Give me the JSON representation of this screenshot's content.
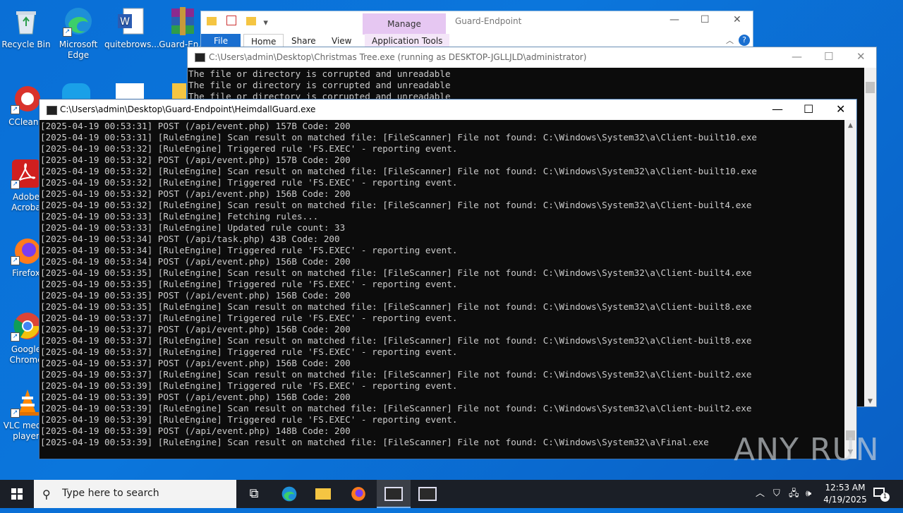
{
  "desktop": {
    "icons": [
      {
        "label": "Recycle Bin"
      },
      {
        "label": "Microsoft Edge"
      },
      {
        "label": "quitebrows..."
      },
      {
        "label": "Guard-En..."
      },
      {
        "label": "CCleane"
      },
      {
        "label": "Adobe Acroba"
      },
      {
        "label": "Firefox"
      },
      {
        "label": "Google Chrome"
      },
      {
        "label": "VLC media player"
      }
    ]
  },
  "explorer": {
    "manage_label": "Manage",
    "title": "Guard-Endpoint",
    "tabs": [
      "File",
      "Home",
      "Share",
      "View",
      "Application Tools"
    ],
    "help": "?"
  },
  "xmas_console": {
    "title": "C:\\Users\\admin\\Desktop\\Christmas Tree.exe (running as DESKTOP-JGLLJLD\\administrator)",
    "lines": [
      "The file or directory is corrupted and unreadable",
      "The file or directory is corrupted and unreadable",
      "The file or directory is corrupted and unreadable"
    ]
  },
  "heim_console": {
    "title": "C:\\Users\\admin\\Desktop\\Guard-Endpoint\\HeimdallGuard.exe",
    "lines": [
      "[2025-04-19 00:53:31] POST (/api/event.php) 157B Code: 200",
      "[2025-04-19 00:53:31] [RuleEngine] Scan result on matched file: [FileScanner] File not found: C:\\Windows\\System32\\a\\Client-built10.exe",
      "[2025-04-19 00:53:32] [RuleEngine] Triggered rule 'FS.EXEC' - reporting event.",
      "[2025-04-19 00:53:32] POST (/api/event.php) 157B Code: 200",
      "[2025-04-19 00:53:32] [RuleEngine] Scan result on matched file: [FileScanner] File not found: C:\\Windows\\System32\\a\\Client-built10.exe",
      "[2025-04-19 00:53:32] [RuleEngine] Triggered rule 'FS.EXEC' - reporting event.",
      "[2025-04-19 00:53:32] POST (/api/event.php) 156B Code: 200",
      "[2025-04-19 00:53:32] [RuleEngine] Scan result on matched file: [FileScanner] File not found: C:\\Windows\\System32\\a\\Client-built4.exe",
      "[2025-04-19 00:53:33] [RuleEngine] Fetching rules...",
      "[2025-04-19 00:53:33] [RuleEngine] Updated rule count: 33",
      "[2025-04-19 00:53:34] POST (/api/task.php) 43B Code: 200",
      "[2025-04-19 00:53:34] [RuleEngine] Triggered rule 'FS.EXEC' - reporting event.",
      "[2025-04-19 00:53:34] POST (/api/event.php) 156B Code: 200",
      "[2025-04-19 00:53:35] [RuleEngine] Scan result on matched file: [FileScanner] File not found: C:\\Windows\\System32\\a\\Client-built4.exe",
      "[2025-04-19 00:53:35] [RuleEngine] Triggered rule 'FS.EXEC' - reporting event.",
      "[2025-04-19 00:53:35] POST (/api/event.php) 156B Code: 200",
      "[2025-04-19 00:53:35] [RuleEngine] Scan result on matched file: [FileScanner] File not found: C:\\Windows\\System32\\a\\Client-built8.exe",
      "[2025-04-19 00:53:37] [RuleEngine] Triggered rule 'FS.EXEC' - reporting event.",
      "[2025-04-19 00:53:37] POST (/api/event.php) 156B Code: 200",
      "[2025-04-19 00:53:37] [RuleEngine] Scan result on matched file: [FileScanner] File not found: C:\\Windows\\System32\\a\\Client-built8.exe",
      "[2025-04-19 00:53:37] [RuleEngine] Triggered rule 'FS.EXEC' - reporting event.",
      "[2025-04-19 00:53:37] POST (/api/event.php) 156B Code: 200",
      "[2025-04-19 00:53:37] [RuleEngine] Scan result on matched file: [FileScanner] File not found: C:\\Windows\\System32\\a\\Client-built2.exe",
      "[2025-04-19 00:53:39] [RuleEngine] Triggered rule 'FS.EXEC' - reporting event.",
      "[2025-04-19 00:53:39] POST (/api/event.php) 156B Code: 200",
      "[2025-04-19 00:53:39] [RuleEngine] Scan result on matched file: [FileScanner] File not found: C:\\Windows\\System32\\a\\Client-built2.exe",
      "[2025-04-19 00:53:39] [RuleEngine] Triggered rule 'FS.EXEC' - reporting event.",
      "[2025-04-19 00:53:39] POST (/api/event.php) 148B Code: 200",
      "[2025-04-19 00:53:39] [RuleEngine] Scan result on matched file: [FileScanner] File not found: C:\\Windows\\System32\\a\\Final.exe"
    ]
  },
  "watermark": "ANY RUN",
  "taskbar": {
    "search_placeholder": "Type here to search",
    "clock_time": "12:53 AM",
    "clock_date": "4/19/2025",
    "notification_count": "1"
  },
  "colors": {
    "desktop_bg": "#0a6fd6",
    "console_bg": "#0c0c0c",
    "console_text": "#cccccc",
    "taskbar_bg": "#1b1f27"
  }
}
